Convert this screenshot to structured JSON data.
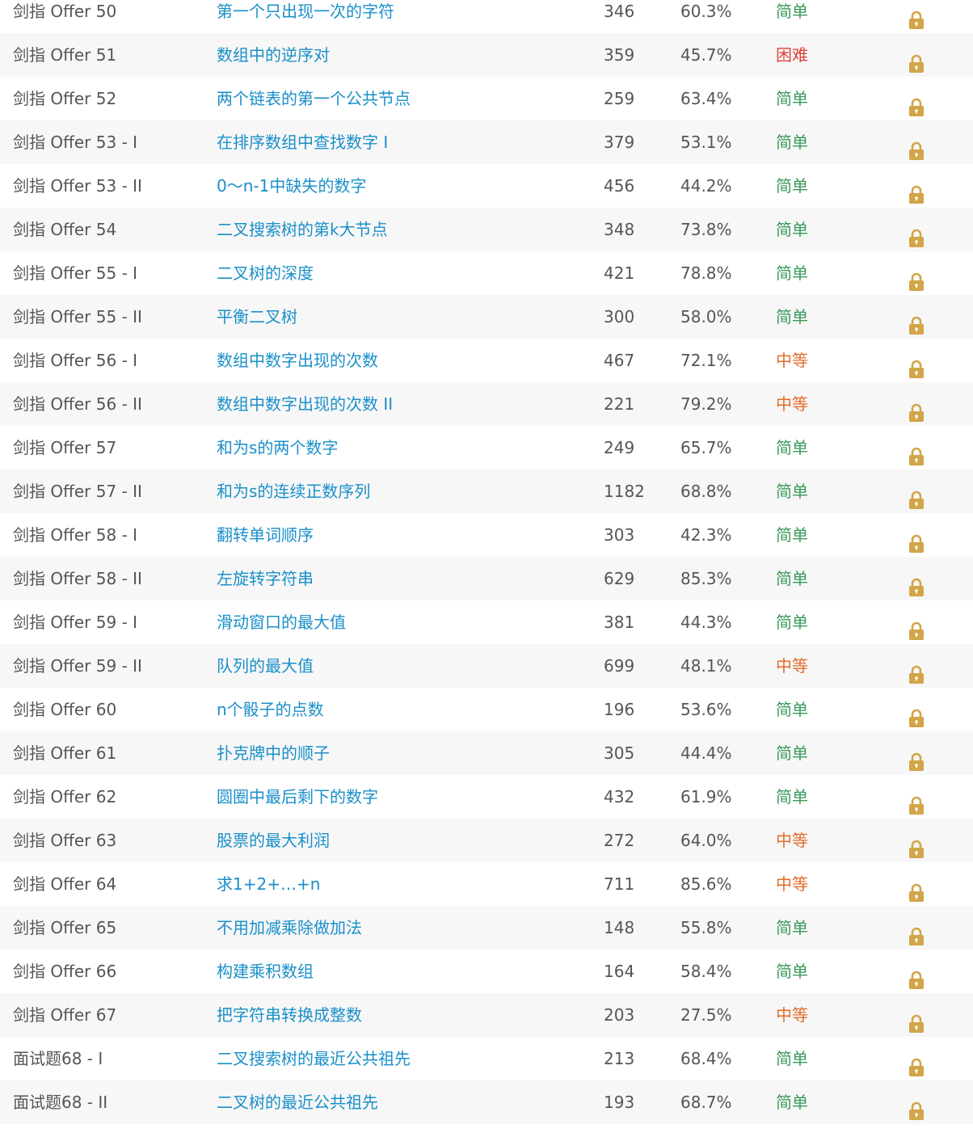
{
  "colors": {
    "link": "#1a8fc9",
    "text": "#555555",
    "easy": "#3a9a5b",
    "medium": "#e06c2c",
    "hard": "#e0423a",
    "lock": "#d2a548",
    "row_alt": "#f7f7f7"
  },
  "lock_icon": "lock-icon",
  "rows": [
    {
      "id": "剑指 Offer 50",
      "title": "第一个只出现一次的字符",
      "solutions": "346",
      "rate": "60.3%",
      "difficulty": "简单",
      "level": "easy"
    },
    {
      "id": "剑指 Offer 51",
      "title": "数组中的逆序对",
      "solutions": "359",
      "rate": "45.7%",
      "difficulty": "困难",
      "level": "hard"
    },
    {
      "id": "剑指 Offer 52",
      "title": "两个链表的第一个公共节点",
      "solutions": "259",
      "rate": "63.4%",
      "difficulty": "简单",
      "level": "easy"
    },
    {
      "id": "剑指 Offer 53 - I",
      "title": "在排序数组中查找数字 I",
      "solutions": "379",
      "rate": "53.1%",
      "difficulty": "简单",
      "level": "easy"
    },
    {
      "id": "剑指 Offer 53 - II",
      "title": "0～n-1中缺失的数字",
      "solutions": "456",
      "rate": "44.2%",
      "difficulty": "简单",
      "level": "easy"
    },
    {
      "id": "剑指 Offer 54",
      "title": "二叉搜索树的第k大节点",
      "solutions": "348",
      "rate": "73.8%",
      "difficulty": "简单",
      "level": "easy"
    },
    {
      "id": "剑指 Offer 55 - I",
      "title": "二叉树的深度",
      "solutions": "421",
      "rate": "78.8%",
      "difficulty": "简单",
      "level": "easy"
    },
    {
      "id": "剑指 Offer 55 - II",
      "title": "平衡二叉树",
      "solutions": "300",
      "rate": "58.0%",
      "difficulty": "简单",
      "level": "easy"
    },
    {
      "id": "剑指 Offer 56 - I",
      "title": "数组中数字出现的次数",
      "solutions": "467",
      "rate": "72.1%",
      "difficulty": "中等",
      "level": "medium"
    },
    {
      "id": "剑指 Offer 56 - II",
      "title": "数组中数字出现的次数 II",
      "solutions": "221",
      "rate": "79.2%",
      "difficulty": "中等",
      "level": "medium"
    },
    {
      "id": "剑指 Offer 57",
      "title": "和为s的两个数字",
      "solutions": "249",
      "rate": "65.7%",
      "difficulty": "简单",
      "level": "easy"
    },
    {
      "id": "剑指 Offer 57 - II",
      "title": "和为s的连续正数序列",
      "solutions": "1182",
      "rate": "68.8%",
      "difficulty": "简单",
      "level": "easy"
    },
    {
      "id": "剑指 Offer 58 - I",
      "title": "翻转单词顺序",
      "solutions": "303",
      "rate": "42.3%",
      "difficulty": "简单",
      "level": "easy"
    },
    {
      "id": "剑指 Offer 58 - II",
      "title": "左旋转字符串",
      "solutions": "629",
      "rate": "85.3%",
      "difficulty": "简单",
      "level": "easy"
    },
    {
      "id": "剑指 Offer 59 - I",
      "title": "滑动窗口的最大值",
      "solutions": "381",
      "rate": "44.3%",
      "difficulty": "简单",
      "level": "easy"
    },
    {
      "id": "剑指 Offer 59 - II",
      "title": "队列的最大值",
      "solutions": "699",
      "rate": "48.1%",
      "difficulty": "中等",
      "level": "medium"
    },
    {
      "id": "剑指 Offer 60",
      "title": "n个骰子的点数",
      "solutions": "196",
      "rate": "53.6%",
      "difficulty": "简单",
      "level": "easy"
    },
    {
      "id": "剑指 Offer 61",
      "title": "扑克牌中的顺子",
      "solutions": "305",
      "rate": "44.4%",
      "difficulty": "简单",
      "level": "easy"
    },
    {
      "id": "剑指 Offer 62",
      "title": "圆圈中最后剩下的数字",
      "solutions": "432",
      "rate": "61.9%",
      "difficulty": "简单",
      "level": "easy"
    },
    {
      "id": "剑指 Offer 63",
      "title": "股票的最大利润",
      "solutions": "272",
      "rate": "64.0%",
      "difficulty": "中等",
      "level": "medium"
    },
    {
      "id": "剑指 Offer 64",
      "title": "求1+2+…+n",
      "solutions": "711",
      "rate": "85.6%",
      "difficulty": "中等",
      "level": "medium"
    },
    {
      "id": "剑指 Offer 65",
      "title": "不用加减乘除做加法",
      "solutions": "148",
      "rate": "55.8%",
      "difficulty": "简单",
      "level": "easy"
    },
    {
      "id": "剑指 Offer 66",
      "title": "构建乘积数组",
      "solutions": "164",
      "rate": "58.4%",
      "difficulty": "简单",
      "level": "easy"
    },
    {
      "id": "剑指 Offer 67",
      "title": "把字符串转换成整数",
      "solutions": "203",
      "rate": "27.5%",
      "difficulty": "中等",
      "level": "medium"
    },
    {
      "id": "面试题68 - I",
      "title": "二叉搜索树的最近公共祖先",
      "solutions": "213",
      "rate": "68.4%",
      "difficulty": "简单",
      "level": "easy"
    },
    {
      "id": "面试题68 - II",
      "title": "二叉树的最近公共祖先",
      "solutions": "193",
      "rate": "68.7%",
      "difficulty": "简单",
      "level": "easy"
    }
  ]
}
